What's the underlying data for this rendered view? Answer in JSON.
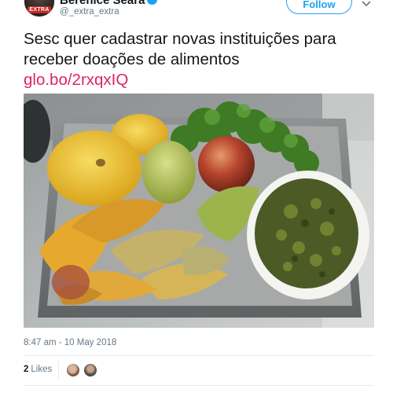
{
  "header": {
    "display_name": "Berenice Seara",
    "handle": "@_extra_extra",
    "avatar_badge": "EXTRA",
    "follow_label": "Follow",
    "verified_icon": "verified-badge-icon",
    "menu_icon": "chevron-down-icon"
  },
  "tweet": {
    "text": "Sesc quer cadastrar novas instituições para receber doações de alimentos",
    "link": "glo.bo/2rxqxIQ",
    "link_color": "#e0245e"
  },
  "photo": {
    "subject": "tray-of-fruits-peels-and-greens"
  },
  "footer": {
    "timestamp": "8:47 am - 10 May 2018",
    "likes_count": "2",
    "likes_label": "Likes"
  },
  "colors": {
    "accent": "#1da1f2",
    "text": "#14171a",
    "muted": "#657786"
  }
}
